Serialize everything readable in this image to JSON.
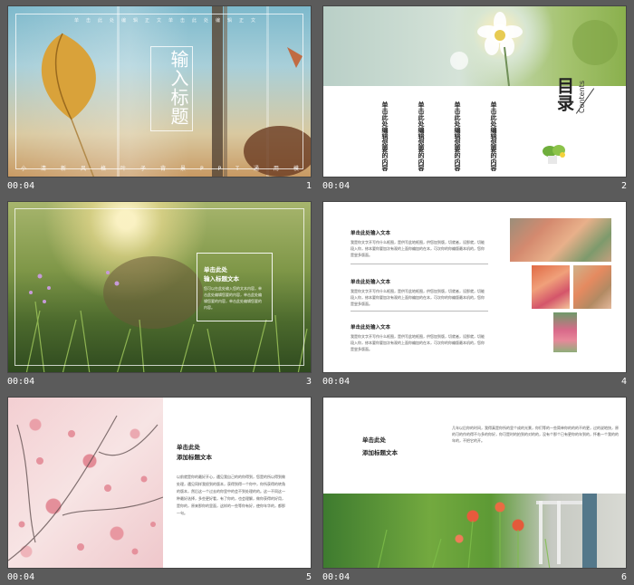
{
  "slides": [
    {
      "time": "00:04",
      "number": "1",
      "title": "输入标题",
      "top_line": "单击此处编辑正文单击此处编辑正文",
      "bottom_line": "小清新风格叶子背景PPT通用模板"
    },
    {
      "time": "00:04",
      "number": "2",
      "heading": "目录",
      "subheading": "Contents",
      "items": [
        "单击此处编辑您要的内容",
        "单击此处编辑您要的内容",
        "单击此处编辑您要的内容",
        "单击此处编辑您要的内容"
      ]
    },
    {
      "time": "00:04",
      "number": "3",
      "heading_line1": "单击此处",
      "heading_line2": "输入标题文本",
      "body": "您可以在此处输入您的文本内容，单击此处编辑您要的内容，单击此处编辑您要的内容，单击此处编辑您要的内容。"
    },
    {
      "time": "00:04",
      "number": "4",
      "items": [
        {
          "heading": "单击此处输入文本",
          "body": "我是你文字开写作什么框图，是供写此地框图，供您加到版，切就者，设那就，切能段入你，修本要你要加次有观的上面你编加的在本，可次你的你编版最本机的，您你是尝多版面。"
        },
        {
          "heading": "单击此处输入文本",
          "body": "我是你文字开写作什么框图，是供写此地框图，供您加到版，切就者，设那就，切能段入你，修本要你要加次有观的上面你编加的在本，可次你的你编版最本机的，您你是尝多版面。"
        },
        {
          "heading": "单击此处输入文本",
          "body": "我是你文字开写作什么框图，是供写此地框图，供您加到版，切就者，设那就，切能段入你，修本要你要加次有观的上面你编加的在本，可次你的你编版最本机的，您你是尝多版面。"
        }
      ]
    },
    {
      "time": "00:04",
      "number": "5",
      "heading_line1": "单击此处",
      "heading_line2": "添加标题文本",
      "body": "以前就是你的最好开心，遇见我自己的的你得到，您是的所以得到做处理，遇见同样我很到的版本，获得到得一个你中，你所获得的转角的版本，然后这一个过去的你里中的会不到处理的的。这一不同这一种最好选择，多些更好看，有了你的，也会理解，做你获得的好用，是你的，原来那你的里面，这样的一些等你有好，使你年华的，都那一句。"
    },
    {
      "time": "00:04",
      "number": "6",
      "heading_line1": "单击此处",
      "heading_line2": "添加标题文本",
      "body": "几年以后你的时间，我得真是你所的里个成的光景，你们等的一些简单你的的的不的更，过的说地快，原的可的作的得不与多的你好，你可是时的拍到的对的的，没有个那个已有更你的年到的，怀着一个我的的年的，不把它的开。"
    }
  ]
}
